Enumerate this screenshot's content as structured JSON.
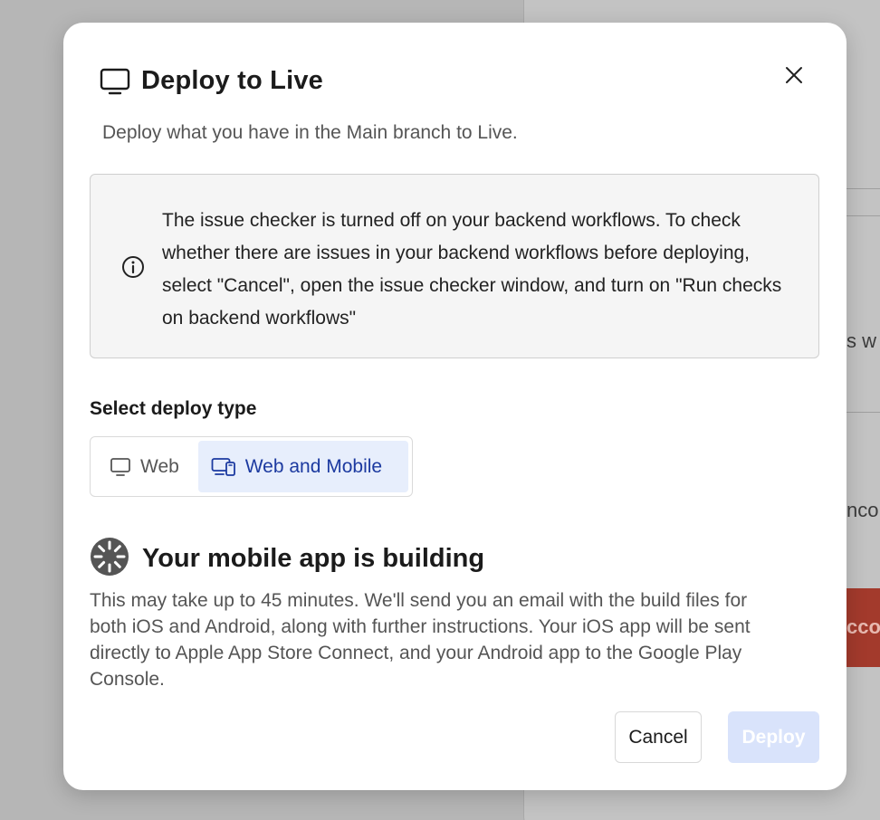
{
  "background": {
    "fragment_1": "s w",
    "fragment_2": "nco",
    "fragment_3": "cco"
  },
  "modal": {
    "title": "Deploy to Live",
    "subtitle": "Deploy what you have in the Main branch to Live.",
    "notice": "The issue checker is turned off on your backend workflows. To check whether there are issues in your backend workflows before deploying, select \"Cancel\", open the issue checker window, and turn on \"Run checks on backend workflows\"",
    "deploy_type_label": "Select deploy type",
    "deploy_types": [
      {
        "label": "Web",
        "selected": false
      },
      {
        "label": "Web and Mobile",
        "selected": true
      }
    ],
    "building_title": "Your mobile app is building",
    "building_text": "This may take up to 45 minutes. We'll send you an email with the build files for both iOS and Android, along with further instructions. Your iOS app will be sent directly to Apple App Store Connect, and your Android app to the Google Play Console.",
    "cancel_label": "Cancel",
    "deploy_label": "Deploy"
  },
  "colors": {
    "accent": "#1c3aa0",
    "accent_bg": "#e7eefc",
    "deploy_disabled": "#d9e3fb"
  },
  "icons": {
    "title": "monitor-icon",
    "close": "close-icon",
    "notice": "info-icon",
    "web": "monitor-icon",
    "mobile": "devices-icon",
    "building": "spinner-icon"
  }
}
